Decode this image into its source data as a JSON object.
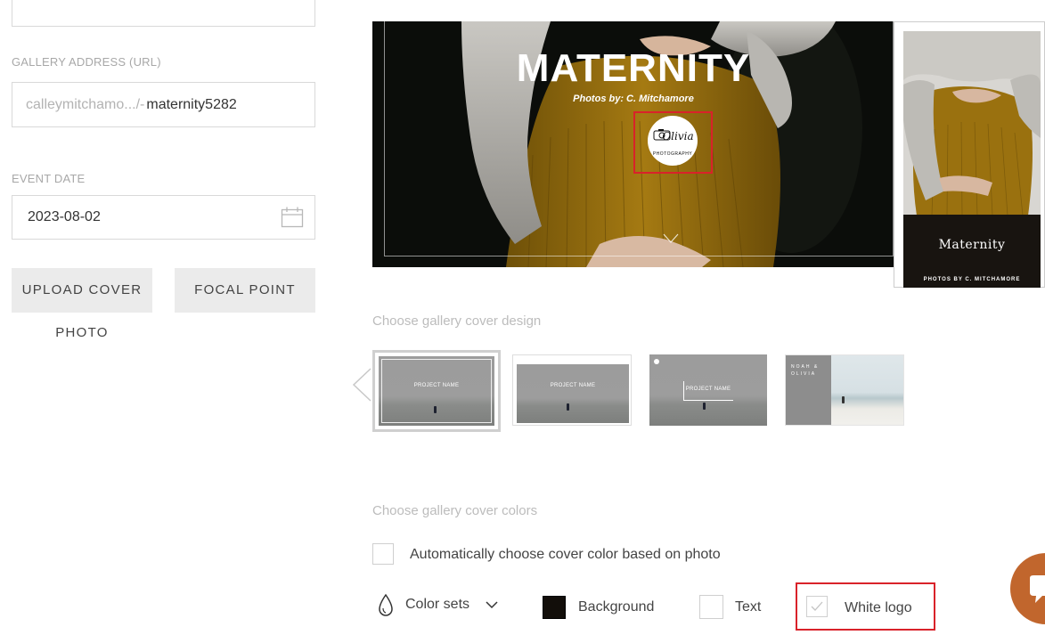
{
  "left_panel": {
    "gallery_address_label": "GALLERY ADDRESS (URL)",
    "url_prefix": "calleymitchamo.../-",
    "url_slug": "maternity5282",
    "event_date_label": "EVENT DATE",
    "event_date_value": "2023-08-02",
    "upload_cover_line1": "UPLOAD COVER",
    "upload_cover_line2": "PHOTO",
    "focal_point_label": "FOCAL POINT"
  },
  "cover_preview": {
    "title": "MATERNITY",
    "subtitle": "Photos by: C. Mitchamore",
    "logo_script": "Olivia",
    "logo_caption": "PHOTOGRAPHY"
  },
  "mobile_preview": {
    "title": "Maternity",
    "subtitle": "PHOTOS BY C. MITCHAMORE"
  },
  "design_section": {
    "heading": "Choose gallery cover design",
    "thumbnails": [
      {
        "label": "PROJECT NAME"
      },
      {
        "label": "PROJECT NAME"
      },
      {
        "label": "PROJECT NAME"
      },
      {
        "label": "NOAH & OLIVIA"
      }
    ]
  },
  "colors_section": {
    "heading": "Choose gallery cover colors",
    "auto_color_label": "Automatically choose cover color based on photo",
    "color_sets_label": "Color sets",
    "background_label": "Background",
    "text_label": "Text",
    "white_logo_label": "White logo",
    "background_color": "#120e0a",
    "highlight_color": "#d9222a",
    "chat_color": "#c1662d"
  }
}
